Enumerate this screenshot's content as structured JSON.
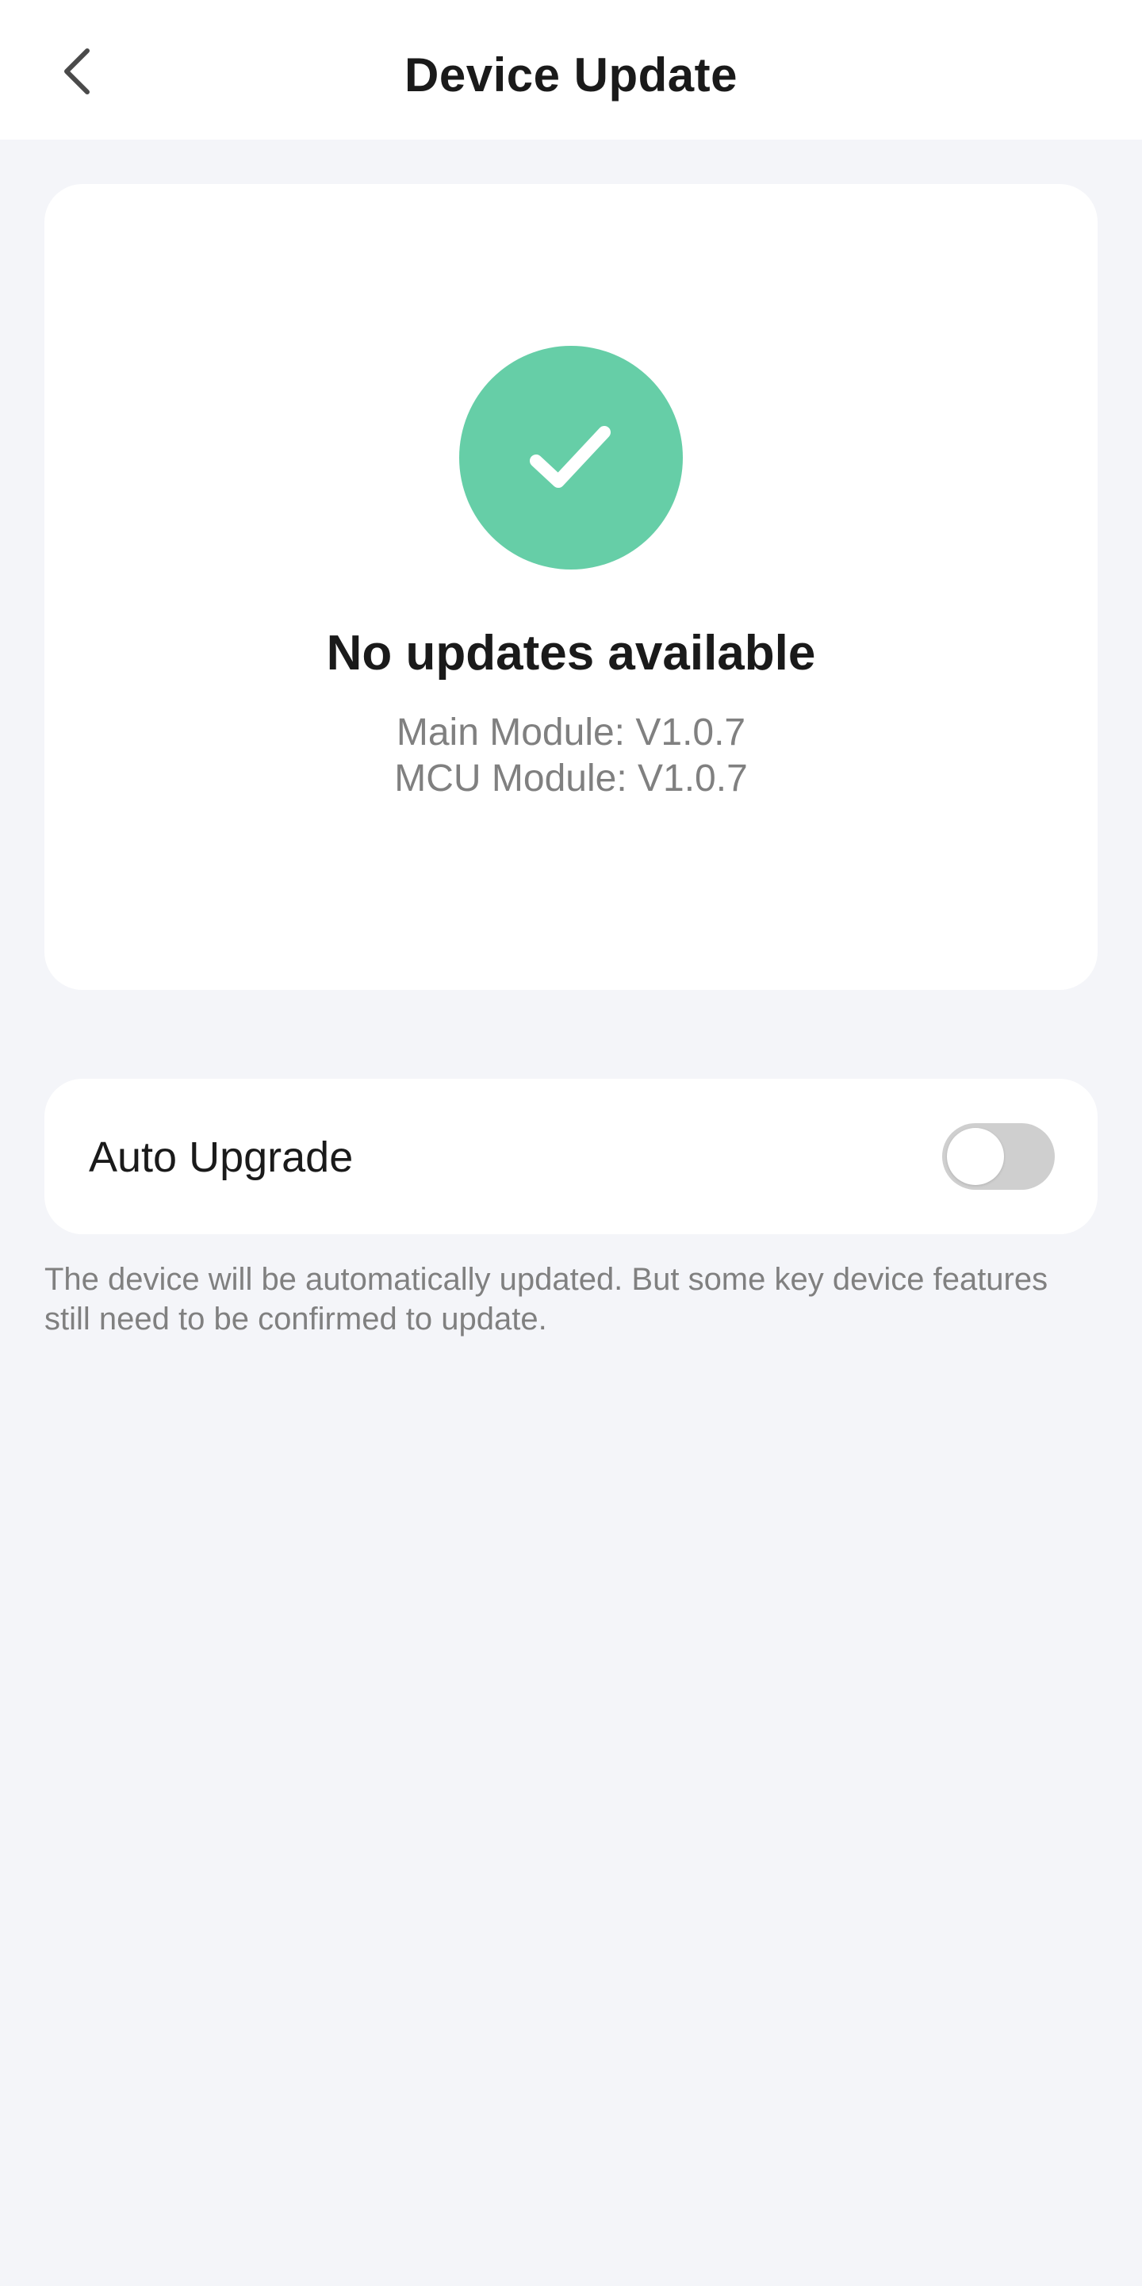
{
  "header": {
    "title": "Device Update",
    "back_icon": "chevron-left-icon"
  },
  "status": {
    "icon": "checkmark-icon",
    "icon_color": "#66cea7",
    "title": "No updates available",
    "main_module": "Main Module: V1.0.7",
    "mcu_module": "MCU Module: V1.0.7"
  },
  "settings": {
    "auto_upgrade_label": "Auto Upgrade",
    "auto_upgrade_enabled": false,
    "hint": "The device will be automatically updated. But some key device features still need to be confirmed to update."
  },
  "colors": {
    "background": "#f4f5f9",
    "card": "#ffffff",
    "accent": "#66cea7",
    "toggle_off": "#cfcfcf"
  }
}
